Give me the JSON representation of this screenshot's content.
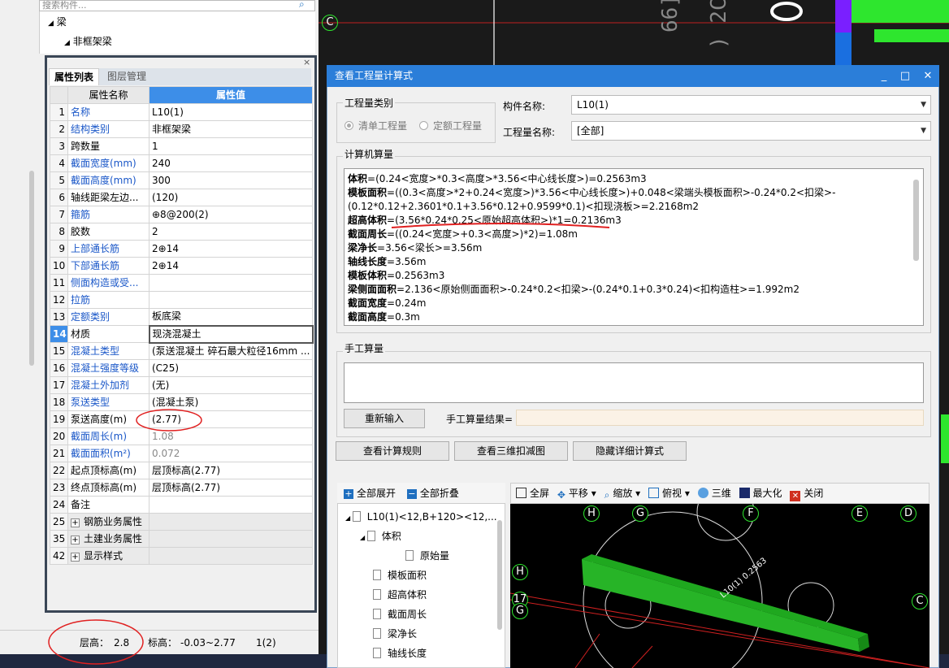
{
  "left_tree": {
    "search_placeholder": "搜索构件...",
    "node_beam": "梁",
    "node_nonframe_beam": "非框架梁"
  },
  "prop_panel": {
    "tab_props": "属性列表",
    "tab_layers": "图层管理",
    "col_name": "属性名称",
    "col_value": "属性值",
    "rows": [
      {
        "num": "1",
        "name": "名称",
        "value": "L10(1)"
      },
      {
        "num": "2",
        "name": "结构类别",
        "value": "非框架梁"
      },
      {
        "num": "3",
        "name": "跨数量",
        "value": "1"
      },
      {
        "num": "4",
        "name": "截面宽度(mm)",
        "value": "240"
      },
      {
        "num": "5",
        "name": "截面高度(mm)",
        "value": "300"
      },
      {
        "num": "6",
        "name": "轴线距梁左边...",
        "value": "(120)"
      },
      {
        "num": "7",
        "name": "箍筋",
        "value": "⊕8@200(2)"
      },
      {
        "num": "8",
        "name": "胶数",
        "value": "2"
      },
      {
        "num": "9",
        "name": "上部通长筋",
        "value": "2⊕14"
      },
      {
        "num": "10",
        "name": "下部通长筋",
        "value": "2⊕14"
      },
      {
        "num": "11",
        "name": "侧面构造或受...",
        "value": ""
      },
      {
        "num": "12",
        "name": "拉筋",
        "value": ""
      },
      {
        "num": "13",
        "name": "定额类别",
        "value": "板底梁"
      },
      {
        "num": "14",
        "name": "材质",
        "value": "现浇混凝土"
      },
      {
        "num": "15",
        "name": "混凝土类型",
        "value": "(泵送混凝土 碎石最大粒径16mm ..."
      },
      {
        "num": "16",
        "name": "混凝土强度等级",
        "value": "(C25)"
      },
      {
        "num": "17",
        "name": "混凝土外加剂",
        "value": "(无)"
      },
      {
        "num": "18",
        "name": "泵送类型",
        "value": "(混凝土泵)"
      },
      {
        "num": "19",
        "name": "泵送高度(m)",
        "value": "(2.77)"
      },
      {
        "num": "20",
        "name": "截面周长(m)",
        "value": "1.08"
      },
      {
        "num": "21",
        "name": "截面面积(m²)",
        "value": "0.072"
      },
      {
        "num": "22",
        "name": "起点顶标高(m)",
        "value": "层顶标高(2.77)"
      },
      {
        "num": "23",
        "name": "终点顶标高(m)",
        "value": "层顶标高(2.77)"
      },
      {
        "num": "24",
        "name": "备注",
        "value": ""
      },
      {
        "num": "25",
        "name": "钢筋业务属性",
        "value": ""
      },
      {
        "num": "35",
        "name": "土建业务属性",
        "value": ""
      },
      {
        "num": "42",
        "name": "显示样式",
        "value": ""
      }
    ]
  },
  "status": {
    "floor_height_label": "层高：",
    "floor_height": "2.8",
    "elevation_label": "标高：",
    "elevation": "-0.03~2.77",
    "count": "1(2)"
  },
  "dialog": {
    "title": "查看工程量计算式",
    "qty_type_legend": "工程量类别",
    "radio_bill": "清单工程量",
    "radio_quota": "定额工程量",
    "component_label": "构件名称:",
    "component_value": "L10(1)",
    "qty_name_label": "工程量名称:",
    "qty_name_value": "[全部]",
    "computer_legend": "计算机算量",
    "calc_lines": [
      {
        "label": "体积",
        "text": "=(0.24<宽度>*0.3<高度>*3.56<中心线长度>)=0.2563m3"
      },
      {
        "label": "模板面积",
        "text": "=((0.3<高度>*2+0.24<宽度>)*3.56<中心线长度>)+0.048<梁端头模板面积>-0.24*0.2<扣梁>-(0.12*0.12+2.3601*0.1+3.56*0.12+0.9599*0.1)<扣现浇板>=2.2168m2"
      },
      {
        "label": "超高体积",
        "text": "=(3.56*0.24*0.25<原始超高体积>)*1=0.2136m3"
      },
      {
        "label": "截面周长",
        "text": "=((0.24<宽度>+0.3<高度>)*2)=1.08m"
      },
      {
        "label": "梁净长",
        "text": "=3.56<梁长>=3.56m"
      },
      {
        "label": "轴线长度",
        "text": "=3.56m"
      },
      {
        "label": "模板体积",
        "text": "=0.2563m3"
      },
      {
        "label": "梁侧面面积",
        "text": "=2.136<原始侧面面积>-0.24*0.2<扣梁>-(0.24*0.1+0.3*0.24)<扣构造柱>=1.992m2"
      },
      {
        "label": "截面宽度",
        "text": "=0.24m"
      },
      {
        "label": "截面高度",
        "text": "=0.3m"
      }
    ],
    "manual_legend": "手工算量",
    "reinput_button": "重新输入",
    "manual_result_label": "手工算量结果=",
    "view_rules_button": "查看计算规则",
    "view_3d_button": "查看三维扣减图",
    "hide_detail_button": "隐藏详细计算式",
    "expand_all": "全部展开",
    "collapse_all": "全部折叠",
    "tree_items": [
      "L10(1)<12,B+120><12,...",
      "体积",
      "原始量",
      "模板面积",
      "超高体积",
      "截面周长",
      "梁净长",
      "轴线长度"
    ],
    "view_tools": {
      "fullscreen": "全屏",
      "pan": "平移",
      "zoom": "缩放",
      "topview": "俯视",
      "view3d": "三维",
      "maximize": "最大化",
      "close": "关闭"
    },
    "axis_labels": [
      "H",
      "G",
      "F",
      "E",
      "D",
      "H",
      "17",
      "G",
      "C"
    ],
    "beam_label": "L10(1) 0.2563"
  },
  "cad_labels": {
    "axis_c": "C"
  }
}
